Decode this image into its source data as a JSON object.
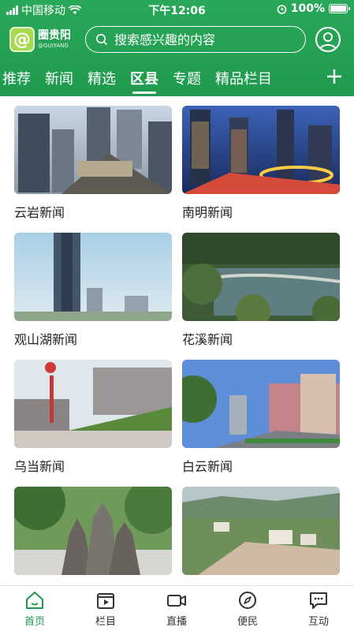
{
  "status_bar": {
    "carrier": "中国移动",
    "time": "下午12:06",
    "battery": "100%"
  },
  "app": {
    "logo_text": "圈贵阳",
    "logo_subtext": "@GUIYANG"
  },
  "search": {
    "placeholder": "搜索感兴趣的内容"
  },
  "tabs": [
    {
      "label": "推荐"
    },
    {
      "label": "新闻"
    },
    {
      "label": "精选"
    },
    {
      "label": "区县",
      "active": true
    },
    {
      "label": "专题"
    },
    {
      "label": "精品栏目"
    }
  ],
  "cards": [
    {
      "title": "云岩新闻"
    },
    {
      "title": "南明新闻"
    },
    {
      "title": "观山湖新闻"
    },
    {
      "title": "花溪新闻"
    },
    {
      "title": "乌当新闻"
    },
    {
      "title": "白云新闻"
    },
    {
      "title": ""
    },
    {
      "title": ""
    }
  ],
  "bottom_nav": [
    {
      "label": "首页",
      "icon": "home-icon",
      "active": true
    },
    {
      "label": "栏目",
      "icon": "column-play-icon"
    },
    {
      "label": "直播",
      "icon": "video-camera-icon"
    },
    {
      "label": "便民",
      "icon": "compass-icon"
    },
    {
      "label": "互动",
      "icon": "chat-bubble-icon"
    }
  ],
  "colors": {
    "brand_green": "#1f9a4e",
    "active_nav": "#1f9a4e"
  }
}
